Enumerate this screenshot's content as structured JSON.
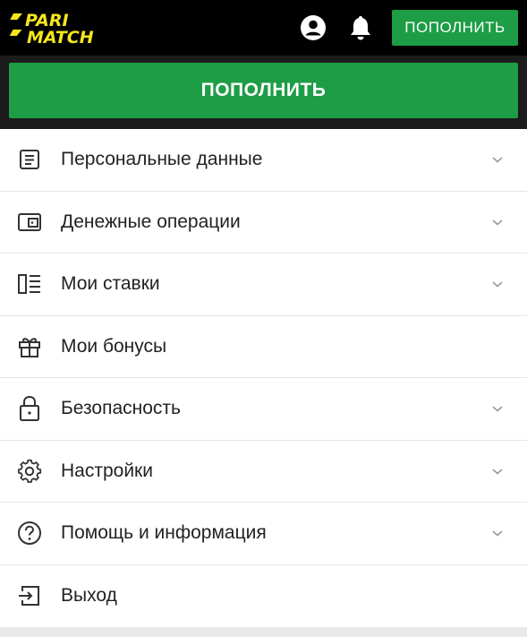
{
  "header": {
    "logo_top": "PARI",
    "logo_bottom": "MATCH",
    "deposit_label": "ПОПОЛНИТЬ",
    "profile_icon": "user-circle-icon",
    "bell_icon": "bell-icon"
  },
  "main": {
    "deposit_label": "ПОПОЛНИТЬ"
  },
  "menu": {
    "items": [
      {
        "label": "Персональные данные",
        "icon": "document-icon",
        "expandable": true
      },
      {
        "label": "Денежные операции",
        "icon": "wallet-icon",
        "expandable": true
      },
      {
        "label": "Мои ставки",
        "icon": "bet-slip-icon",
        "expandable": true
      },
      {
        "label": "Мои бонусы",
        "icon": "gift-icon",
        "expandable": false
      },
      {
        "label": "Безопасность",
        "icon": "lock-icon",
        "expandable": true
      },
      {
        "label": "Настройки",
        "icon": "gear-icon",
        "expandable": true
      },
      {
        "label": "Помощь и информация",
        "icon": "help-icon",
        "expandable": true
      },
      {
        "label": "Выход",
        "icon": "logout-icon",
        "expandable": false
      }
    ]
  },
  "colors": {
    "accent": "#1d9d45",
    "logo": "#f5e61c",
    "topbar": "#000000"
  }
}
